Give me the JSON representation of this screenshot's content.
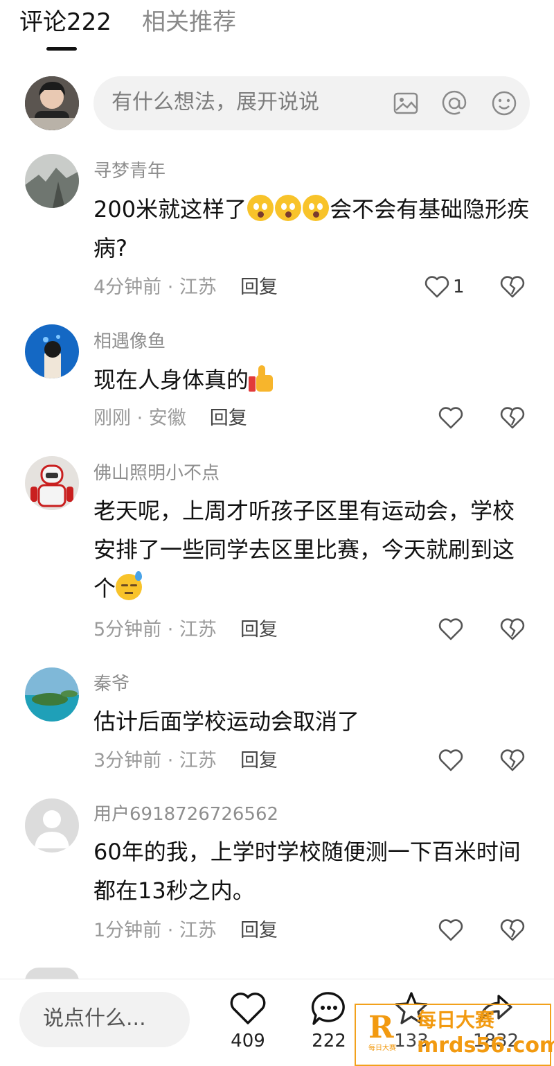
{
  "tabs": {
    "comments": "评论222",
    "related": "相关推荐"
  },
  "compose": {
    "placeholder": "有什么想法，展开说说"
  },
  "comments": [
    {
      "user": "寻梦青年",
      "text_before": "200米就这样了",
      "text_after": "会不会有基础隐形疾病?",
      "emoji_count": 3,
      "time": "4分钟前 · 江苏",
      "reply": "回复",
      "likes": "1"
    },
    {
      "user": "相遇像鱼",
      "text": "现在人身体真的",
      "time": "刚刚 · 安徽",
      "reply": "回复",
      "likes": ""
    },
    {
      "user": "佛山照明小不点",
      "text": "老天呢，上周才听孩子区里有运动会，学校安排了一些同学去区里比赛，今天就刷到这个",
      "time": "5分钟前 · 江苏",
      "reply": "回复",
      "likes": ""
    },
    {
      "user": "秦爷",
      "text": "估计后面学校运动会取消了",
      "time": "3分钟前 · 江苏",
      "reply": "回复",
      "likes": ""
    },
    {
      "user": "用户6918726726562",
      "text": "60年的我，上学时学校随便测一下百米时间都在13秒之内。",
      "time": "1分钟前 · 江苏",
      "reply": "回复",
      "likes": ""
    }
  ],
  "bottom_bar": {
    "input_placeholder": "说点什么...",
    "like_count": "409",
    "comment_count": "222",
    "favorite_count": "133",
    "share_count": "1832"
  },
  "watermark": {
    "letter": "R",
    "line1": "每日大赛",
    "line2": "mrds56.com",
    "small": "每日大赛"
  },
  "icons": [
    "image-icon",
    "at-icon",
    "emoji-icon",
    "heart-icon",
    "broken-heart-icon",
    "comment-icon",
    "star-icon",
    "share-icon"
  ]
}
